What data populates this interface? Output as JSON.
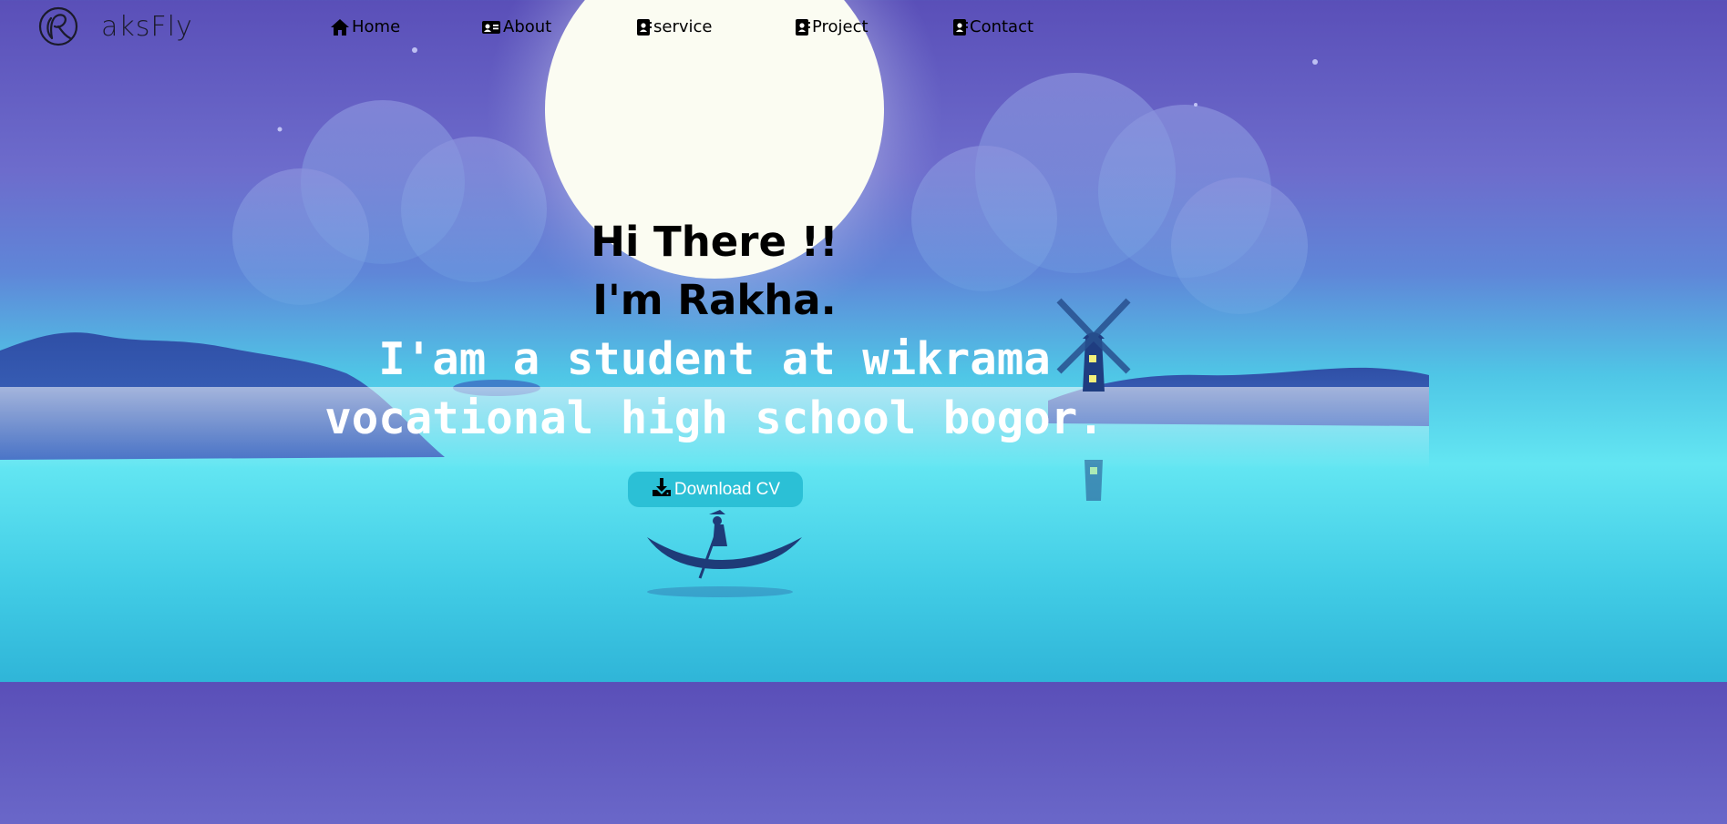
{
  "brand": {
    "name": "aksFly",
    "logo_icon": "r-monogram-logo"
  },
  "nav": {
    "items": [
      {
        "label": "Home",
        "icon": "home-icon"
      },
      {
        "label": "About",
        "icon": "id-card-icon"
      },
      {
        "label": "service",
        "icon": "contact-book-icon"
      },
      {
        "label": "Project",
        "icon": "contact-book-icon"
      },
      {
        "label": "Contact",
        "icon": "contact-book-icon"
      }
    ]
  },
  "hero": {
    "greeting_line1": "Hi There !!",
    "greeting_line2": "I'm Rakha.",
    "tagline": "I'am a student at wikrama vocational high school bogor.",
    "cta_label": "Download CV",
    "cta_icon": "download-icon"
  },
  "colors": {
    "button": "#2bc0d6",
    "sky_top": "#5a4fb8",
    "water": "#63e6f2",
    "moon": "#fbfcf2"
  }
}
